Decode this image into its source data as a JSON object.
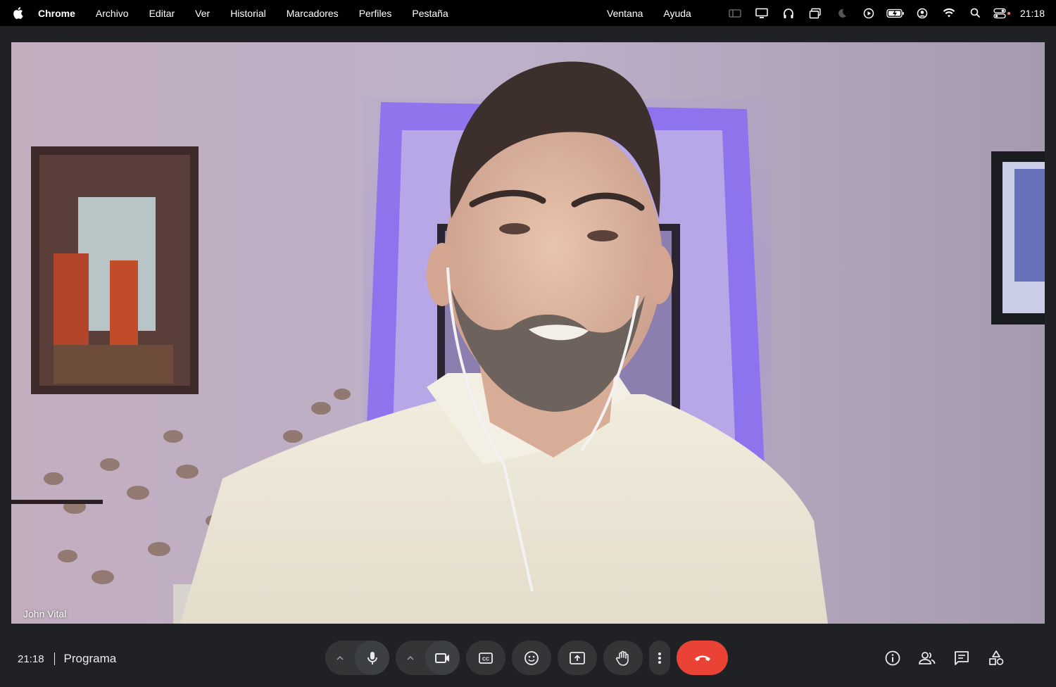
{
  "menubar": {
    "app_name": "Chrome",
    "items": [
      "Archivo",
      "Editar",
      "Ver",
      "Historial",
      "Marcadores",
      "Perfiles",
      "Pestaña"
    ],
    "right_items": [
      "Ventana",
      "Ayuda"
    ],
    "status_icons": [
      "sidebar-icon",
      "display-icon",
      "headphones-icon",
      "window-icon",
      "moon-icon",
      "play-icon",
      "battery-icon",
      "user-icon",
      "wifi-icon",
      "search-icon",
      "control-center-icon"
    ],
    "clock": "21:18"
  },
  "video": {
    "participant_name": "John Vital"
  },
  "meeting": {
    "time": "21:18",
    "name": "Programa"
  },
  "controls": {
    "mic_icon": "microphone-icon",
    "camera_icon": "camera-icon",
    "captions_icon": "closed-captions-icon",
    "reactions_icon": "emoji-icon",
    "present_icon": "present-screen-icon",
    "raise_hand_icon": "hand-icon",
    "more_icon": "more-vert-icon",
    "leave_icon": "hang-up-icon",
    "leave_color": "#ea4335"
  },
  "side_controls": [
    "info-icon",
    "people-icon",
    "chat-icon",
    "activities-icon"
  ]
}
